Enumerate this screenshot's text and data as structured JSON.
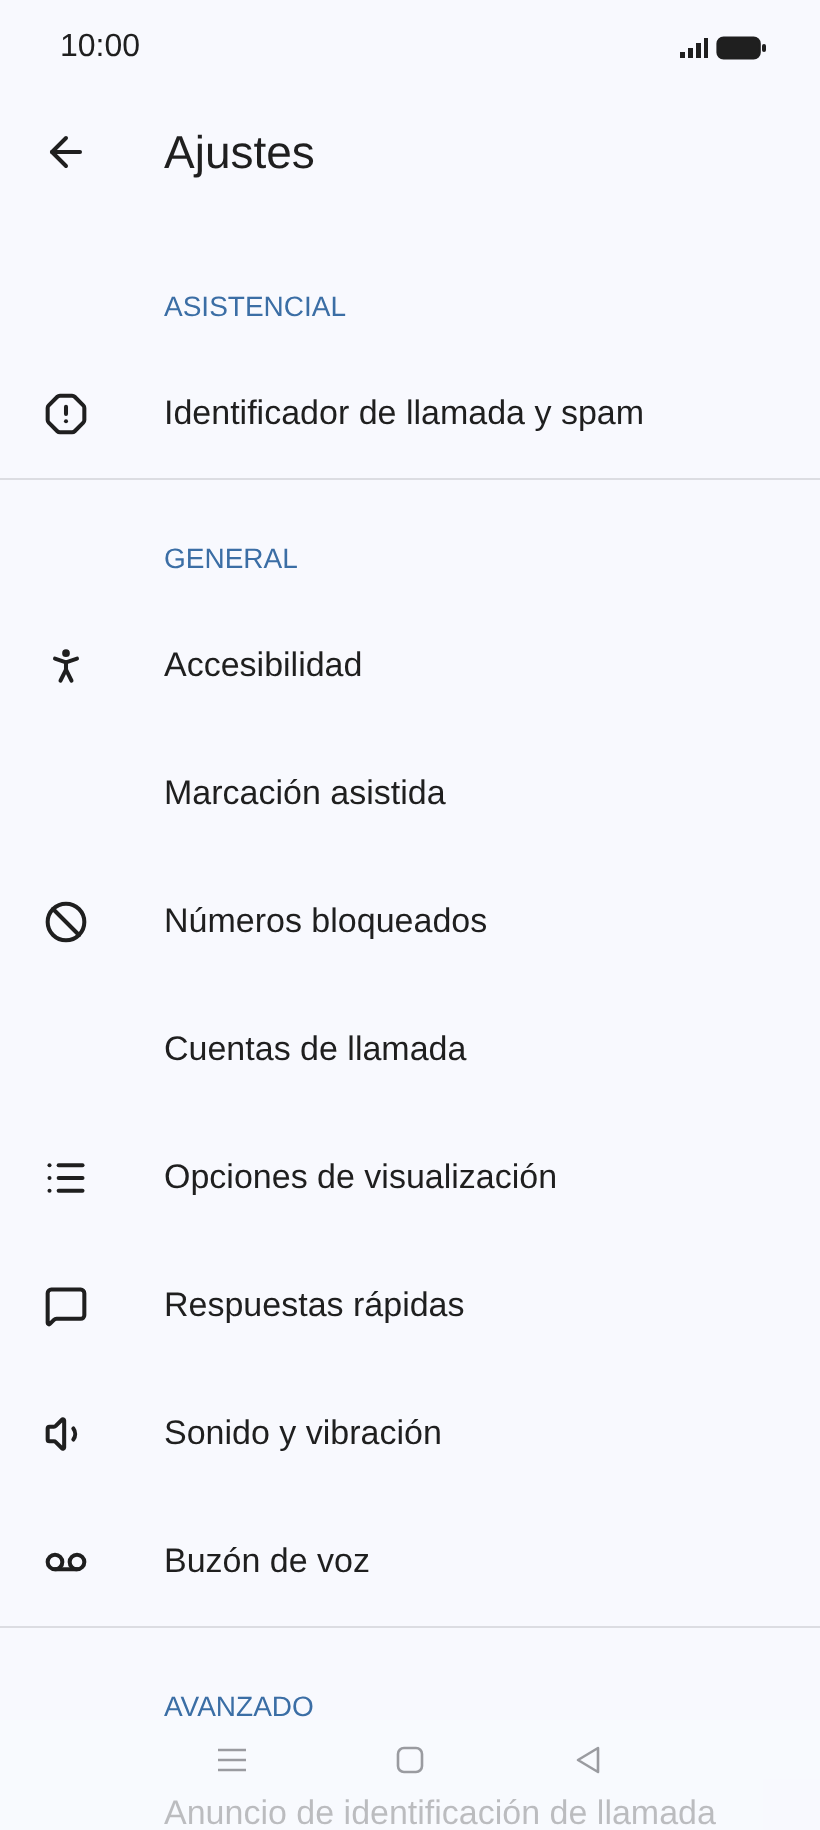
{
  "status_bar": {
    "time": "10:00"
  },
  "header": {
    "title": "Ajustes"
  },
  "sections": [
    {
      "title": "ASISTENCIAL",
      "items": [
        {
          "label": "Identificador de llamada y spam",
          "kind": "alert"
        }
      ]
    },
    {
      "title": "GENERAL",
      "items": [
        {
          "label": "Accesibilidad",
          "kind": "accessibility"
        },
        {
          "label": "Marcación asistida"
        },
        {
          "label": "Números bloqueados",
          "kind": "block"
        },
        {
          "label": "Cuentas de llamada"
        },
        {
          "label": "Opciones de visualización",
          "kind": "list"
        },
        {
          "label": "Respuestas rápidas",
          "kind": "message"
        },
        {
          "label": "Sonido y vibración",
          "kind": "volume"
        },
        {
          "label": "Buzón de voz",
          "kind": "voicemail"
        }
      ]
    },
    {
      "title": "AVANZADO",
      "items": [
        {
          "label": "Anuncio de identificación de llamada"
        }
      ]
    }
  ]
}
